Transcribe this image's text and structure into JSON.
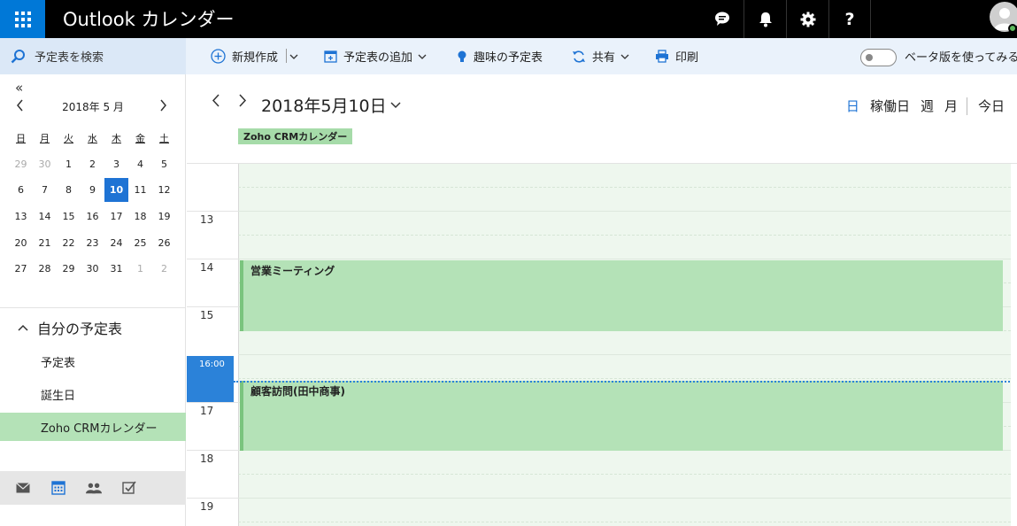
{
  "app": {
    "title": "Outlook カレンダー"
  },
  "topbar": {
    "icons": [
      "app-launcher-icon",
      "chat-icon",
      "bell-icon",
      "gear-icon",
      "help-icon",
      "avatar-icon"
    ]
  },
  "search": {
    "label": "予定表を検索"
  },
  "commands": {
    "new_label": "新規作成",
    "add_calendar_label": "予定表の追加",
    "interests_label": "趣味の予定表",
    "share_label": "共有",
    "print_label": "印刷",
    "beta_label": "ベータ版を使ってみる"
  },
  "mini_calendar": {
    "collapse": "«",
    "title": "2018年 5 月",
    "weekdays": [
      "日",
      "月",
      "火",
      "水",
      "木",
      "金",
      "土"
    ],
    "weeks": [
      [
        "29",
        "30",
        "1",
        "2",
        "3",
        "4",
        "5"
      ],
      [
        "6",
        "7",
        "8",
        "9",
        "10",
        "11",
        "12"
      ],
      [
        "13",
        "14",
        "15",
        "16",
        "17",
        "18",
        "19"
      ],
      [
        "20",
        "21",
        "22",
        "23",
        "24",
        "25",
        "26"
      ],
      [
        "27",
        "28",
        "29",
        "30",
        "31",
        "1",
        "2"
      ]
    ],
    "selected": "10"
  },
  "my_calendars": {
    "header": "自分の予定表",
    "items": [
      {
        "label": "予定表"
      },
      {
        "label": "誕生日"
      },
      {
        "label": "Zoho CRMカレンダー"
      }
    ]
  },
  "bottom_nav": {
    "icons": [
      "mail-icon",
      "calendar-icon",
      "people-icon",
      "tasks-icon"
    ]
  },
  "day_view": {
    "date_title": "2018年5月10日",
    "views": {
      "day": "日",
      "workweek": "稼働日",
      "week": "週",
      "month": "月",
      "today": "今日"
    },
    "calendar_tag": "Zoho CRMカレンダー",
    "hours": [
      "13",
      "14",
      "15",
      "17",
      "18",
      "19"
    ],
    "now_label": "16:00",
    "events": [
      {
        "title": "営業ミーティング"
      },
      {
        "title": "顧客訪問(田中商事)"
      }
    ]
  },
  "colors": {
    "accent": "#0078d7",
    "event": "#b4e2b7",
    "event_bar": "#7ac47e",
    "selected_day": "#1e73d4"
  }
}
